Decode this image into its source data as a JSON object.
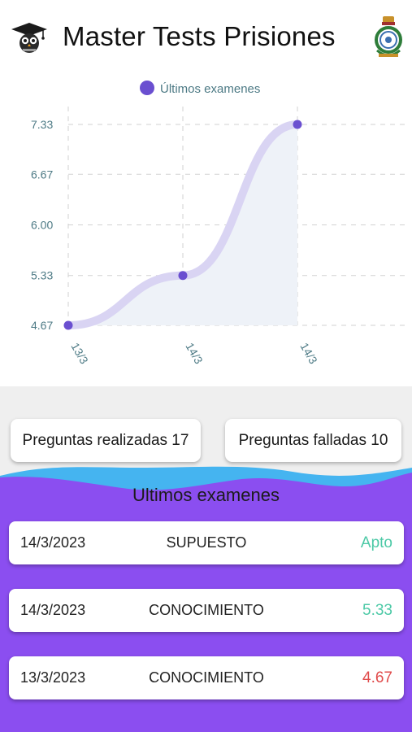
{
  "header": {
    "title": "Master Tests Prisiones"
  },
  "chart_data": {
    "type": "line",
    "legend": "Últimos examenes",
    "legend_position": "top-center",
    "categories": [
      "13/3",
      "14/3",
      "14/3"
    ],
    "series": [
      {
        "name": "Últimos examenes",
        "values": [
          4.67,
          5.33,
          7.33
        ]
      }
    ],
    "y_ticks": [
      "4.67",
      "5.33",
      "6.00",
      "6.67",
      "7.33"
    ],
    "ylim": [
      4.67,
      7.33
    ],
    "grid": true,
    "colors": {
      "line": "#d9d4f3",
      "point": "#6a4fd0",
      "fill": "#eef2f8",
      "tick": "#4d7a85",
      "grid": "#d2d2d2"
    }
  },
  "stats": {
    "done_label": "Preguntas realizadas 17",
    "failed_label": "Preguntas falladas 10"
  },
  "exams": {
    "title": "Ultimos examenes",
    "rows": [
      {
        "date": "14/3/2023",
        "type": "SUPUESTO",
        "result": "Apto",
        "color": "#4cc9a6"
      },
      {
        "date": "14/3/2023",
        "type": "CONOCIMIENTO",
        "result": "5.33",
        "color": "#4cc9a6"
      },
      {
        "date": "13/3/2023",
        "type": "CONOCIMIENTO",
        "result": "4.67",
        "color": "#e04b4b"
      }
    ]
  },
  "colors": {
    "wave_blue": "#45b4f0",
    "wave_purple": "#8b4ef0"
  }
}
